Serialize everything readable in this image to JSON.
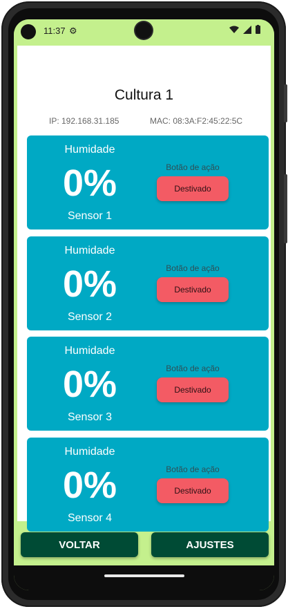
{
  "status_bar": {
    "time": "11:37"
  },
  "page": {
    "title": "Cultura 1",
    "ip": "IP: 192.168.31.185",
    "mac": "MAC: 08:3A:F2:45:22:5C"
  },
  "sensors": [
    {
      "metric": "Humidade",
      "value": "0%",
      "name": "Sensor 1",
      "action_label": "Botão de ação",
      "action_button": "Destivado"
    },
    {
      "metric": "Humidade",
      "value": "0%",
      "name": "Sensor 2",
      "action_label": "Botão de ação",
      "action_button": "Destivado"
    },
    {
      "metric": "Humidade",
      "value": "0%",
      "name": "Sensor 3",
      "action_label": "Botão de ação",
      "action_button": "Destivado"
    },
    {
      "metric": "Humidade",
      "value": "0%",
      "name": "Sensor 4",
      "action_label": "Botão de ação",
      "action_button": "Destivado"
    }
  ],
  "buttons": {
    "back": "VOLTAR",
    "settings": "AJUSTES"
  },
  "colors": {
    "background": "#c4f08d",
    "card": "#00a9c4",
    "action_button": "#f35b64",
    "bottom_button": "#004b35"
  }
}
